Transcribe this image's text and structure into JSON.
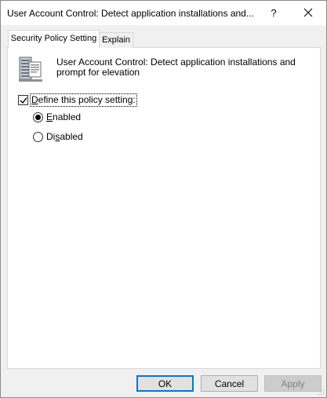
{
  "window": {
    "title": "User Account Control: Detect application installations and...",
    "help_label": "?"
  },
  "tabs": [
    {
      "label": "Security Policy Setting",
      "active": true
    },
    {
      "label": "Explain",
      "active": false
    }
  ],
  "policy": {
    "icon": "server-policy-icon",
    "title": "User Account Control: Detect application installations and prompt for elevation"
  },
  "define_setting": {
    "label_underline": "D",
    "label_rest": "efine this policy setting:",
    "checked": true
  },
  "options": [
    {
      "underline": "E",
      "rest": "nabled",
      "selected": true
    },
    {
      "pre": "Di",
      "underline": "s",
      "rest": "abled",
      "selected": false
    }
  ],
  "buttons": {
    "ok": "OK",
    "cancel": "Cancel",
    "apply": "Apply"
  },
  "colors": {
    "focus_accent": "#0078d7",
    "panel_bg": "#ffffff",
    "dialog_bg": "#f0f0f0"
  }
}
